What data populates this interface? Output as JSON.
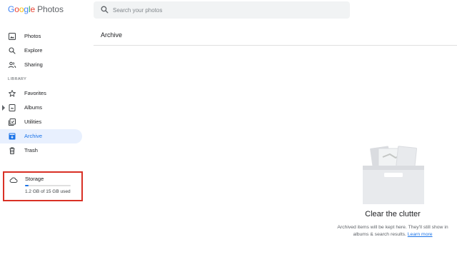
{
  "app": {
    "logo_word": "Google",
    "product": "Photos"
  },
  "search": {
    "placeholder": "Search your photos",
    "value": ""
  },
  "sidebar": {
    "items": [
      {
        "label": "Photos",
        "icon": "photo-icon"
      },
      {
        "label": "Explore",
        "icon": "search-icon"
      },
      {
        "label": "Sharing",
        "icon": "people-icon"
      }
    ],
    "library_label": "LIBRARY",
    "library_items": [
      {
        "label": "Favorites",
        "icon": "star-icon"
      },
      {
        "label": "Albums",
        "icon": "album-icon"
      },
      {
        "label": "Utilities",
        "icon": "utilities-icon"
      },
      {
        "label": "Archive",
        "icon": "archive-icon",
        "active": true
      },
      {
        "label": "Trash",
        "icon": "trash-icon"
      }
    ]
  },
  "storage": {
    "title": "Storage",
    "used_text": "1.2 GB of 15 GB used",
    "used_fraction": 0.08
  },
  "main": {
    "title": "Archive",
    "empty_title": "Clear the clutter",
    "empty_desc": "Archived items will be kept here. They'll still show in albums & search results.",
    "learn_more": "Learn more"
  },
  "colors": {
    "accent": "#1a73e8",
    "active_bg": "#e8f0fe",
    "highlight_border": "#d93025"
  }
}
